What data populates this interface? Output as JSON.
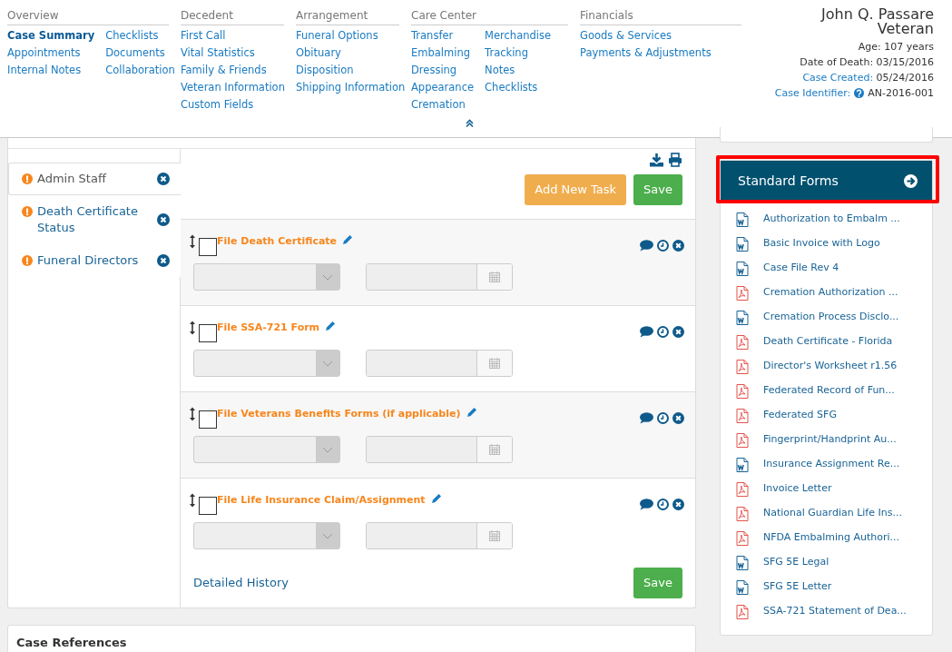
{
  "nav": [
    {
      "title": "Overview",
      "columns": [
        [
          {
            "label": "Case Summary",
            "selected": true
          },
          {
            "label": "Appointments",
            "selected": false
          },
          {
            "label": "Internal Notes",
            "selected": false
          }
        ],
        [
          {
            "label": "Checklists",
            "selected": false
          },
          {
            "label": "Documents",
            "selected": false
          },
          {
            "label": "Collaboration",
            "selected": false
          }
        ]
      ]
    },
    {
      "title": "Decedent",
      "columns": [
        [
          {
            "label": "First Call",
            "selected": false
          },
          {
            "label": "Vital Statistics",
            "selected": false
          },
          {
            "label": "Family & Friends",
            "selected": false
          },
          {
            "label": "Veteran Information",
            "selected": false
          },
          {
            "label": "Custom Fields",
            "selected": false
          }
        ]
      ]
    },
    {
      "title": "Arrangement",
      "columns": [
        [
          {
            "label": "Funeral Options",
            "selected": false
          },
          {
            "label": "Obituary",
            "selected": false
          },
          {
            "label": "Disposition",
            "selected": false
          },
          {
            "label": "Shipping Information",
            "selected": false
          }
        ]
      ]
    },
    {
      "title": "Care Center",
      "columns": [
        [
          {
            "label": "Transfer",
            "selected": false
          },
          {
            "label": "Embalming",
            "selected": false
          },
          {
            "label": "Dressing",
            "selected": false
          },
          {
            "label": "Appearance",
            "selected": false
          },
          {
            "label": "Cremation",
            "selected": false
          }
        ],
        [
          {
            "label": "Merchandise",
            "selected": false
          },
          {
            "label": "Tracking",
            "selected": false
          },
          {
            "label": "Notes",
            "selected": false
          },
          {
            "label": "Checklists",
            "selected": false
          }
        ]
      ]
    },
    {
      "title": "Financials",
      "columns": [
        [
          {
            "label": "Goods & Services",
            "selected": false
          },
          {
            "label": "Payments & Adjustments",
            "selected": false
          }
        ]
      ]
    }
  ],
  "patient": {
    "name": "John Q. Passare",
    "status": "Veteran",
    "age": "Age: 107 years",
    "date_of_death": "Date of Death: 03/15/2016",
    "case_created_label": "Case Created:",
    "case_created": "05/24/2016",
    "case_identifier_label": "Case Identifier:",
    "case_identifier": "AN-2016-001"
  },
  "tabs": [
    {
      "label": "Admin Staff",
      "selected": true
    },
    {
      "label": "Death Certificate Status",
      "selected": false
    },
    {
      "label": "Funeral Directors",
      "selected": false
    }
  ],
  "add_task": "Add New Task",
  "save": "Save",
  "tasks": [
    {
      "title": "File Death Certificate",
      "checked": false
    },
    {
      "title": "File SSA-721 Form",
      "checked": false
    },
    {
      "title": "File Veterans Benefits Forms (if applicable)",
      "checked": false
    },
    {
      "title": "File Life Insurance Claim/Assignment",
      "checked": false
    }
  ],
  "detailed_history": "Detailed History",
  "save_bottom": "Save",
  "case_references": "Case References",
  "forms": {
    "title": "Standard Forms",
    "highlighted": true,
    "items": [
      {
        "label": "Authorization to Embalm ...",
        "kind": "word"
      },
      {
        "label": "Basic Invoice with Logo",
        "kind": "word"
      },
      {
        "label": "Case File Rev 4",
        "kind": "word"
      },
      {
        "label": "Cremation Authorization ...",
        "kind": "pdf"
      },
      {
        "label": "Cremation Process Disclo...",
        "kind": "word"
      },
      {
        "label": "Death Certificate - Florida",
        "kind": "pdf"
      },
      {
        "label": "Director's Worksheet r1.56",
        "kind": "pdf"
      },
      {
        "label": "Federated Record of Fun...",
        "kind": "pdf"
      },
      {
        "label": "Federated SFG",
        "kind": "pdf"
      },
      {
        "label": "Fingerprint/Handprint Au...",
        "kind": "pdf"
      },
      {
        "label": "Insurance Assignment Re...",
        "kind": "word"
      },
      {
        "label": "Invoice Letter",
        "kind": "pdf"
      },
      {
        "label": "National Guardian Life Ins...",
        "kind": "pdf"
      },
      {
        "label": "NFDA Embalming Authori...",
        "kind": "pdf"
      },
      {
        "label": "SFG 5E Legal",
        "kind": "word"
      },
      {
        "label": "SFG 5E Letter",
        "kind": "word"
      },
      {
        "label": "SSA-721 Statement of Dea...",
        "kind": "pdf"
      }
    ]
  }
}
